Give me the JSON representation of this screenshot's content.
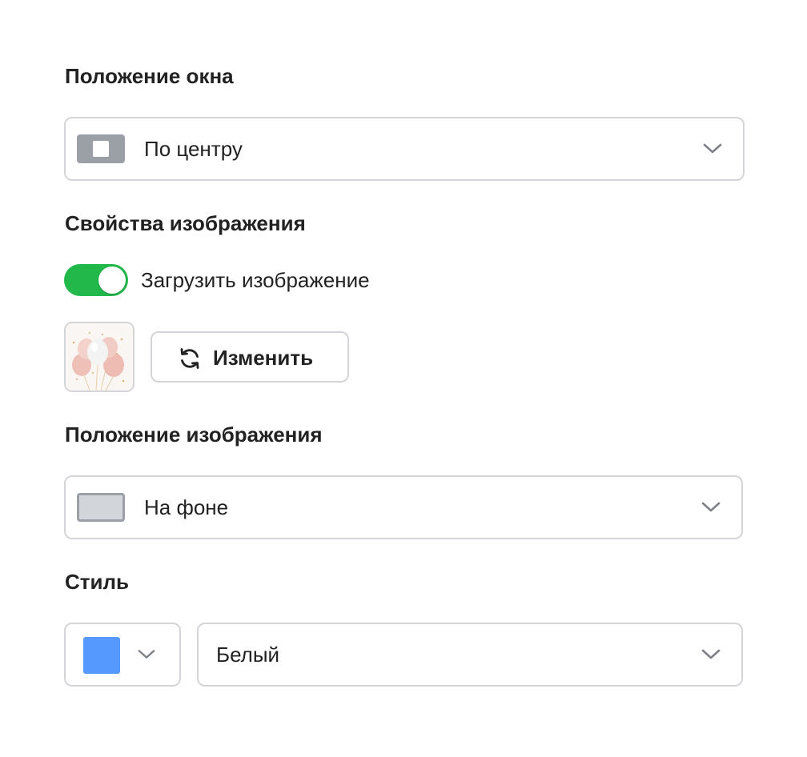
{
  "window_position": {
    "heading": "Положение окна",
    "selected": "По центру",
    "icon": "center-position-icon"
  },
  "image_properties": {
    "heading": "Свойства изображения",
    "upload_toggle": {
      "label": "Загрузить изображение",
      "checked": true,
      "on_color": "#22b84a"
    },
    "thumbnail_icon": "balloons-image",
    "change_button_label": "Изменить",
    "change_button_icon": "refresh-icon"
  },
  "image_position": {
    "heading": "Положение изображения",
    "selected": "На фоне",
    "icon": "background-position-icon"
  },
  "style": {
    "heading": "Стиль",
    "color_swatch": "#5599ff",
    "selected": "Белый"
  },
  "colors": {
    "border": "#d3d5d9",
    "icon_gray": "#9aa0a6",
    "chevron": "#7d8187",
    "text": "#222222"
  }
}
